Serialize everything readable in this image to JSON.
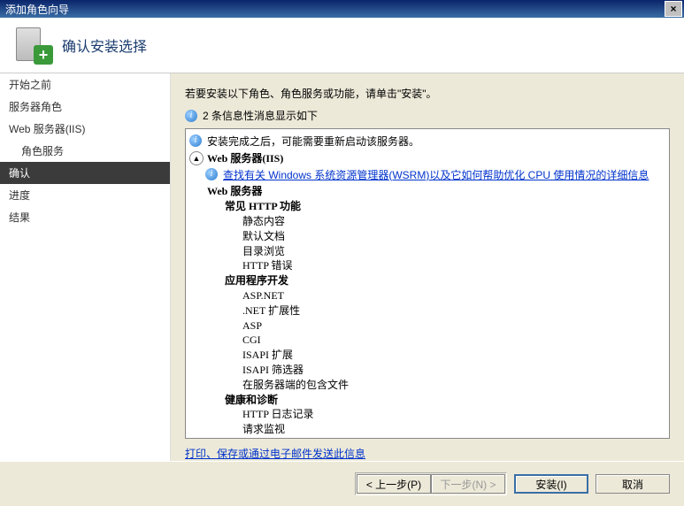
{
  "window": {
    "title": "添加角色向导",
    "close": "×"
  },
  "header": {
    "title": "确认安装选择"
  },
  "sidebar": {
    "items": [
      {
        "label": "开始之前",
        "selected": false,
        "sub": false
      },
      {
        "label": "服务器角色",
        "selected": false,
        "sub": false
      },
      {
        "label": "Web 服务器(IIS)",
        "selected": false,
        "sub": false
      },
      {
        "label": "角色服务",
        "selected": false,
        "sub": true
      },
      {
        "label": "确认",
        "selected": true,
        "sub": false
      },
      {
        "label": "进度",
        "selected": false,
        "sub": false
      },
      {
        "label": "结果",
        "selected": false,
        "sub": false
      }
    ]
  },
  "main": {
    "instruction": "若要安装以下角色、角色服务或功能，请单击\"安装\"。",
    "info_count_line": "2 条信息性消息显示如下",
    "info1": "安装完成之后，可能需要重新启动该服务器。",
    "section_title": "Web 服务器(IIS)",
    "wsrm_link_prefix": "查找有关 ",
    "wsrm_link": "Windows 系统资源管理器(WSRM)以及它如何帮助优化 CPU 使用情况的详细信息",
    "tree": {
      "t1_1": "Web 服务器",
      "t2_1": "常见 HTTP 功能",
      "t3_1": "静态内容",
      "t3_2": "默认文档",
      "t3_3": "目录浏览",
      "t3_4": "HTTP 错误",
      "t2_2": "应用程序开发",
      "t3_5": "ASP.NET",
      "t3_6": ".NET 扩展性",
      "t3_7": "ASP",
      "t3_8": "CGI",
      "t3_9": "ISAPI 扩展",
      "t3_10": "ISAPI 筛选器",
      "t3_11": "在服务器端的包含文件",
      "t2_3": "健康和诊断",
      "t3_12": "HTTP 日志记录",
      "t3_13": "请求监视"
    },
    "print_link": "打印、保存或通过电子邮件发送此信息"
  },
  "footer": {
    "prev": "< 上一步(P)",
    "next": "下一步(N) >",
    "install": "安装(I)",
    "cancel": "取消"
  }
}
